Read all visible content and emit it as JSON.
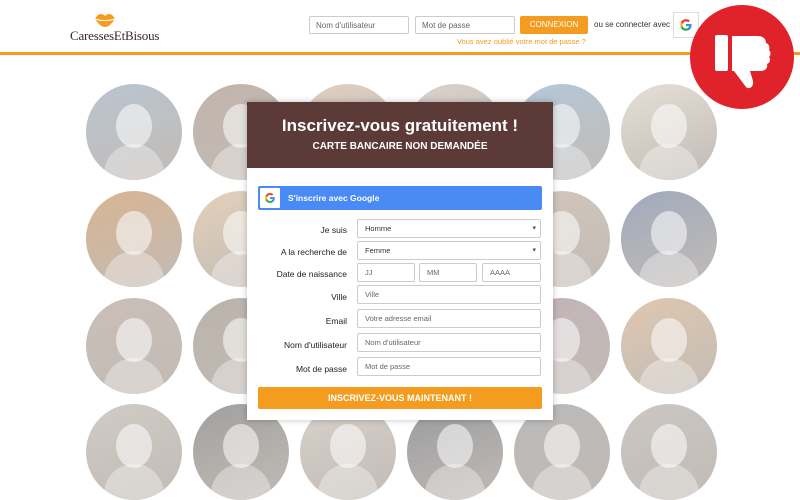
{
  "header": {
    "logo_text": "CaressesEtBisous",
    "username_placeholder": "Nom d'utilisateur",
    "password_placeholder": "Mot de passe",
    "login_button": "CONNEXION",
    "or_connect_text": "ou se connecter avec",
    "forgot_password": "Vous avez oublié votre mot de passe ?",
    "accent_color": "#f39c20"
  },
  "badge": {
    "icon": "thumbs-down-icon",
    "color": "#e0232a"
  },
  "signup": {
    "title": "Inscrivez-vous gratuitement !",
    "subtitle": "CARTE BANCAIRE NON DEMANDÉE",
    "google_button": "S'inscrire avec Google",
    "labels": {
      "je_suis": "Je suis",
      "recherche": "A la recherche de",
      "naissance": "Date de naissance",
      "ville": "Ville",
      "email": "Email",
      "username": "Nom d'utilisateur",
      "password": "Mot de passe"
    },
    "values": {
      "je_suis": "Homme",
      "recherche": "Femme"
    },
    "placeholders": {
      "day": "JJ",
      "month": "MM",
      "year": "AAAA",
      "ville": "Ville",
      "email": "Votre adresse email",
      "username": "Nom d'utilisateur",
      "password": "Mot de passe"
    },
    "submit": "INSCRIVEZ-VOUS MAINTENANT !",
    "header_color": "#5c3a38",
    "google_color": "#4a8af4"
  },
  "gallery": {
    "photos": [
      {
        "color": "#7a8fa6"
      },
      {
        "color": "#8a7060"
      },
      {
        "color": "#c4a48a"
      },
      {
        "color": "#b8a89a"
      },
      {
        "color": "#6f95b5"
      },
      {
        "color": "#cfc2b2"
      },
      {
        "color": "#b5702f"
      },
      {
        "color": "#c9a67c"
      },
      {
        "color": "#d8b89c"
      },
      {
        "color": "#c6a690"
      },
      {
        "color": "#a8927c"
      },
      {
        "color": "#4a5d80"
      },
      {
        "color": "#9a8376"
      },
      {
        "color": "#7c6e60"
      },
      {
        "color": "#c0a08a"
      },
      {
        "color": "#b09c88"
      },
      {
        "color": "#8a6f78"
      },
      {
        "color": "#c49468"
      },
      {
        "color": "#a59c92"
      },
      {
        "color": "#4a4a48"
      },
      {
        "color": "#b6a89c"
      },
      {
        "color": "#3e3f48"
      },
      {
        "color": "#7a7a7a"
      },
      {
        "color": "#9a938c"
      }
    ]
  }
}
